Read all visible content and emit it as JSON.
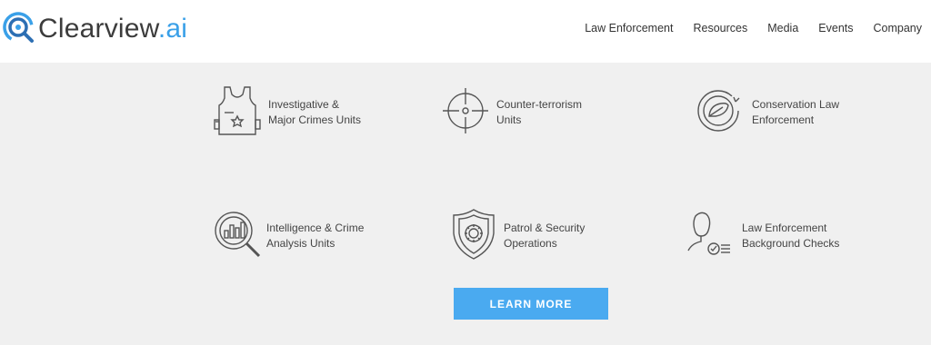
{
  "brand": {
    "name_main": "Clearview",
    "name_suffix": ".ai",
    "accent": "#3aa0e8"
  },
  "nav": {
    "items": [
      {
        "label": "Law Enforcement"
      },
      {
        "label": "Resources"
      },
      {
        "label": "Media"
      },
      {
        "label": "Events"
      },
      {
        "label": "Company"
      }
    ]
  },
  "units": [
    {
      "icon": "vest-icon",
      "line1": "Investigative &",
      "line2": "Major Crimes Units"
    },
    {
      "icon": "crosshair-icon",
      "line1": "Counter-terrorism",
      "line2": "Units"
    },
    {
      "icon": "leaf-recycle-icon",
      "line1": "Conservation Law",
      "line2": "Enforcement"
    },
    {
      "icon": "magnifier-chart-icon",
      "line1": "Intelligence & Crime",
      "line2": "Analysis Units"
    },
    {
      "icon": "shield-gear-icon",
      "line1": "Patrol & Security",
      "line2": "Operations"
    },
    {
      "icon": "person-check-icon",
      "line1": "Law Enforcement",
      "line2": "Background Checks"
    }
  ],
  "cta": {
    "label": "LEARN MORE",
    "color": "#4aaaf0"
  }
}
